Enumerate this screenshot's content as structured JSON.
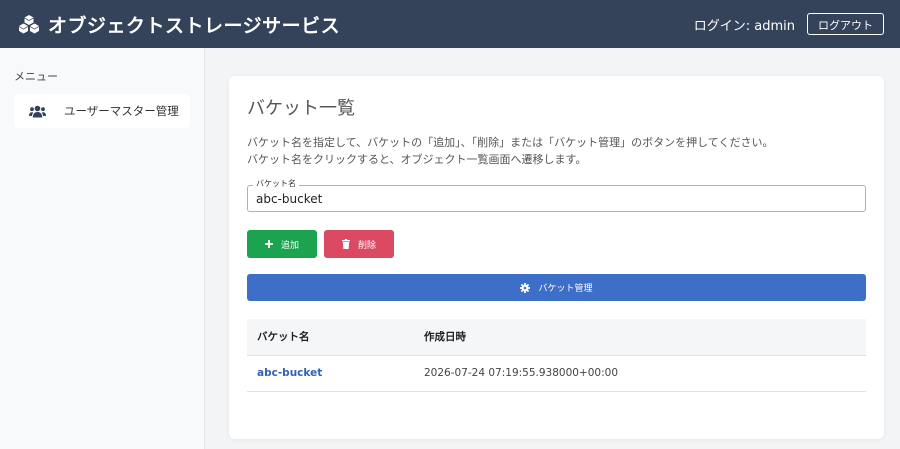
{
  "header": {
    "title": "オブジェクトストレージサービス",
    "login_text": "ログイン: admin",
    "logout_label": "ログアウト",
    "brand_icon": "cubes-icon"
  },
  "sidebar": {
    "menu_title": "メニュー",
    "items": [
      {
        "label": "ユーザーマスター管理",
        "icon": "users-icon"
      }
    ]
  },
  "main": {
    "page_title": "バケット一覧",
    "description_line1": "バケット名を指定して、バケットの「追加」、「削除」または「バケット管理」のボタンを押してください。",
    "description_line2": "バケット名をクリックすると、オブジェクト一覧画面へ遷移します。",
    "field": {
      "label": "バケット名",
      "value": "abc-bucket"
    },
    "buttons": {
      "add_label": "追加",
      "delete_label": "削除",
      "manage_label": "バケット管理"
    },
    "table": {
      "columns": [
        "バケット名",
        "作成日時"
      ],
      "rows": [
        {
          "name": "abc-bucket",
          "created": "2026-07-24 07:19:55.938000+00:00"
        }
      ]
    }
  },
  "colors": {
    "header_bg": "#34435a",
    "add_btn": "#1ba34f",
    "delete_btn": "#dc4963",
    "manage_btn": "#3d6fc8",
    "link": "#3161b5"
  }
}
